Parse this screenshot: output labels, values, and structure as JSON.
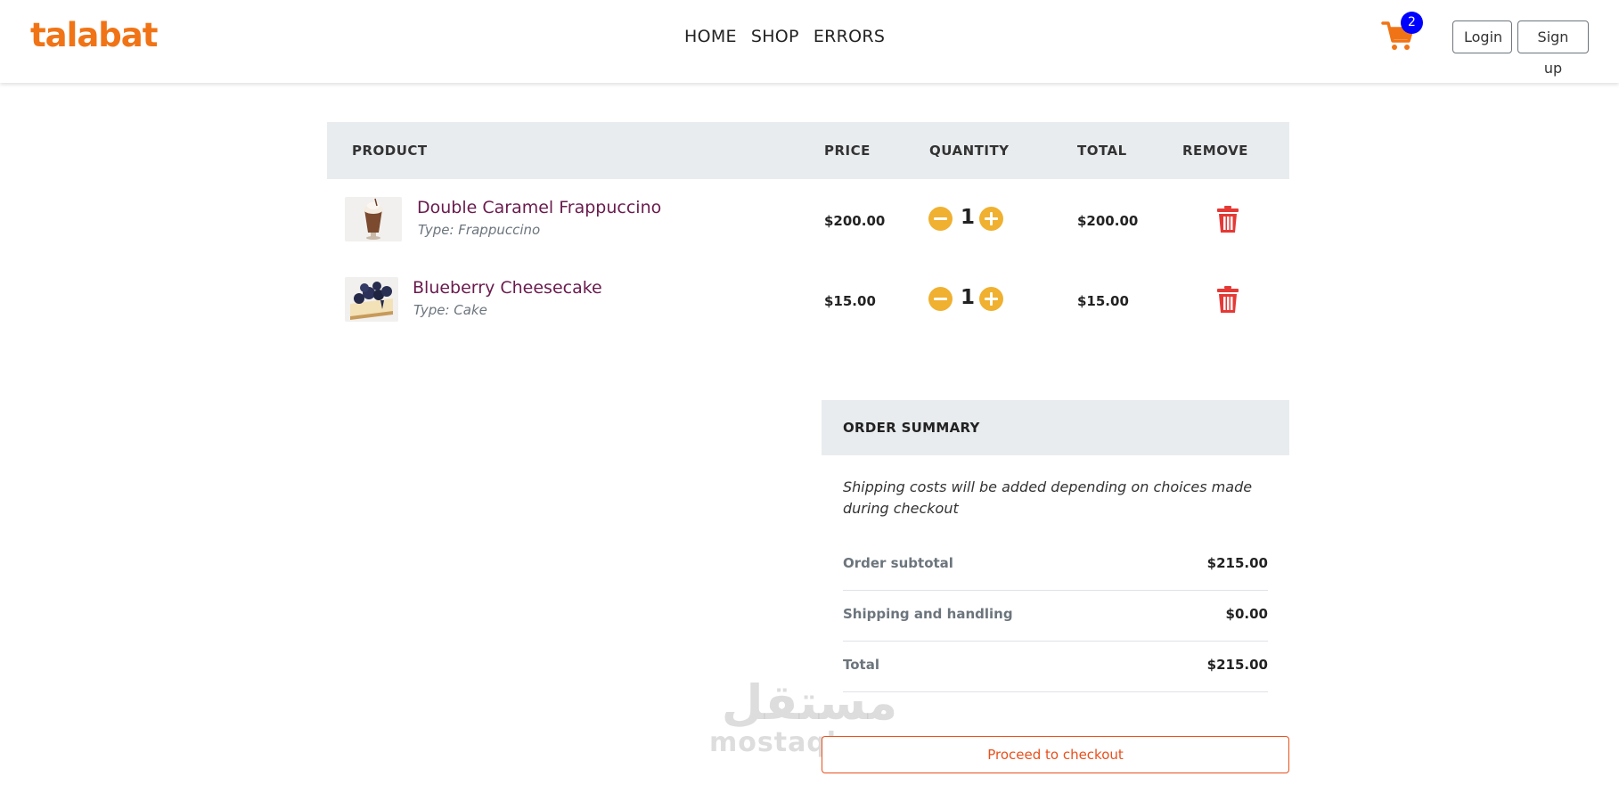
{
  "brand": {
    "logo_text": "talabat",
    "accent": "#f07416"
  },
  "nav": {
    "links": [
      {
        "label": "HOME"
      },
      {
        "label": "SHOP"
      },
      {
        "label": "ERRORS"
      }
    ]
  },
  "header": {
    "cart_icon": "cart-icon",
    "cart_count": "2",
    "login_label": "Login",
    "signup_label": "Sign up"
  },
  "cart_table": {
    "headers": {
      "product": "PRODUCT",
      "price": "PRICE",
      "quantity": "QUANTITY",
      "total": "TOTAL",
      "remove": "REMOVE"
    },
    "items": [
      {
        "name": "Double Caramel Frappuccino",
        "type": "Type: Frappuccino",
        "price": "$200.00",
        "quantity": "1",
        "total": "$200.00",
        "image_icon": "frappuccino-image"
      },
      {
        "name": "Blueberry Cheesecake",
        "type": "Type: Cake",
        "price": "$15.00",
        "quantity": "1",
        "total": "$15.00",
        "image_icon": "cheesecake-image"
      }
    ]
  },
  "summary": {
    "title": "ORDER SUMMARY",
    "note": "Shipping costs will be added depending on choices made during checkout",
    "rows": [
      {
        "label": "Order subtotal",
        "value": "$215.00"
      },
      {
        "label": "Shipping and handling",
        "value": "$0.00"
      },
      {
        "label": "Total",
        "value": "$215.00"
      }
    ],
    "checkout_label": "Proceed to checkout"
  },
  "watermark": {
    "arabic": "مستقل",
    "latin": "mostaql.com"
  },
  "colors": {
    "quantity_button": "#f0b030",
    "trash": "#e53935",
    "checkout": "#e8501c",
    "badge": "#0000ff",
    "product_name": "#6a1b4d"
  }
}
